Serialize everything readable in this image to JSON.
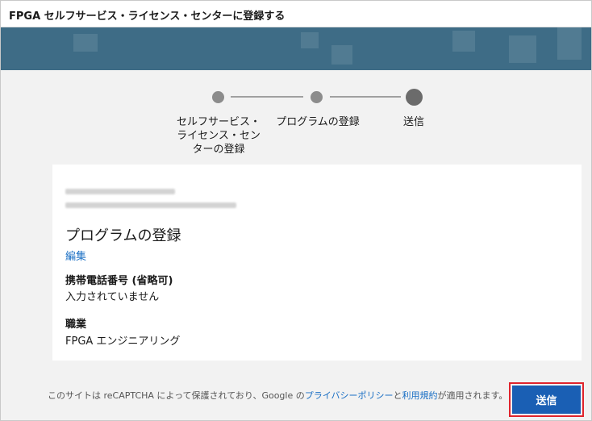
{
  "window": {
    "title": "FPGA セルフサービス・ライセンス・センターに登録する"
  },
  "stepper": {
    "steps": [
      {
        "label_line1": "セルフサービス・",
        "label_line2": "ライセンス・セン",
        "label_line3": "ターの登録",
        "state": "completed"
      },
      {
        "label": "プログラムの登録",
        "state": "completed"
      },
      {
        "label": "送信",
        "state": "current"
      }
    ]
  },
  "card": {
    "account_blurred_line1": "",
    "account_blurred_line2": "",
    "section_title": "プログラムの登録",
    "edit_link": "編集",
    "fields": [
      {
        "label": "携帯電話番号 (省略可)",
        "value": "入力されていません"
      },
      {
        "label": "職業",
        "value": "FPGA エンジニアリング"
      }
    ]
  },
  "footer": {
    "text_before": "このサイトは reCAPTCHA によって保護されており、Google の",
    "privacy_link": "プライバシーポリシー",
    "text_and": "と",
    "terms_link": "利用規約",
    "text_after": "が適用されます。"
  },
  "actions": {
    "submit_label": "送信"
  },
  "colors": {
    "banner": "#3e6c86",
    "accent": "#1a5fb4",
    "link": "#1a6fc4",
    "highlight_border": "#e0242d"
  }
}
